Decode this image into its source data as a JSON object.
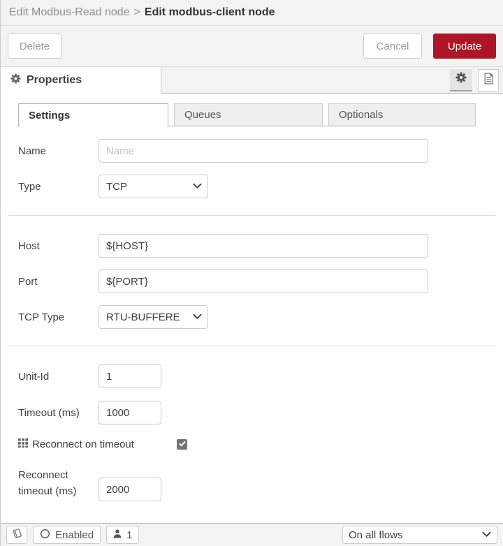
{
  "breadcrumb": {
    "parent": "Edit Modbus-Read node",
    "separator": ">",
    "current": "Edit modbus-client node"
  },
  "toolbar": {
    "delete_label": "Delete",
    "cancel_label": "Cancel",
    "update_label": "Update"
  },
  "panel": {
    "title": "Properties"
  },
  "tabs": [
    {
      "label": "Settings",
      "active": true
    },
    {
      "label": "Queues",
      "active": false
    },
    {
      "label": "Optionals",
      "active": false
    }
  ],
  "fields": {
    "name": {
      "label": "Name",
      "placeholder": "Name",
      "value": ""
    },
    "type": {
      "label": "Type",
      "value": "TCP"
    },
    "host": {
      "label": "Host",
      "value": "${HOST}"
    },
    "port": {
      "label": "Port",
      "value": "${PORT}"
    },
    "tcp_type": {
      "label": "TCP Type",
      "value": "RTU-BUFFERED"
    },
    "unit_id": {
      "label": "Unit-Id",
      "value": "1"
    },
    "timeout": {
      "label": "Timeout (ms)",
      "value": "1000"
    },
    "reconnect": {
      "label": "Reconnect on timeout",
      "checked": true
    },
    "reconnect_timeout": {
      "label_line1": "Reconnect",
      "label_line2": "timeout (ms)",
      "value": "2000"
    }
  },
  "footer": {
    "enabled_label": "Enabled",
    "instance_count": "1",
    "deploy_scope": "On all flows"
  },
  "icons": {
    "gear": "gear-icon",
    "document": "document-icon",
    "grid": "grid-icon",
    "book": "book-icon",
    "circle": "circle-icon",
    "person": "person-icon",
    "chevron": "chevron-down-icon",
    "check": "check-icon"
  },
  "colors": {
    "accent_red": "#AD1625",
    "bar_background": "#f3f3f3",
    "border": "#cccccc",
    "text": "#3f3f3f",
    "muted": "#8e8e8e"
  }
}
